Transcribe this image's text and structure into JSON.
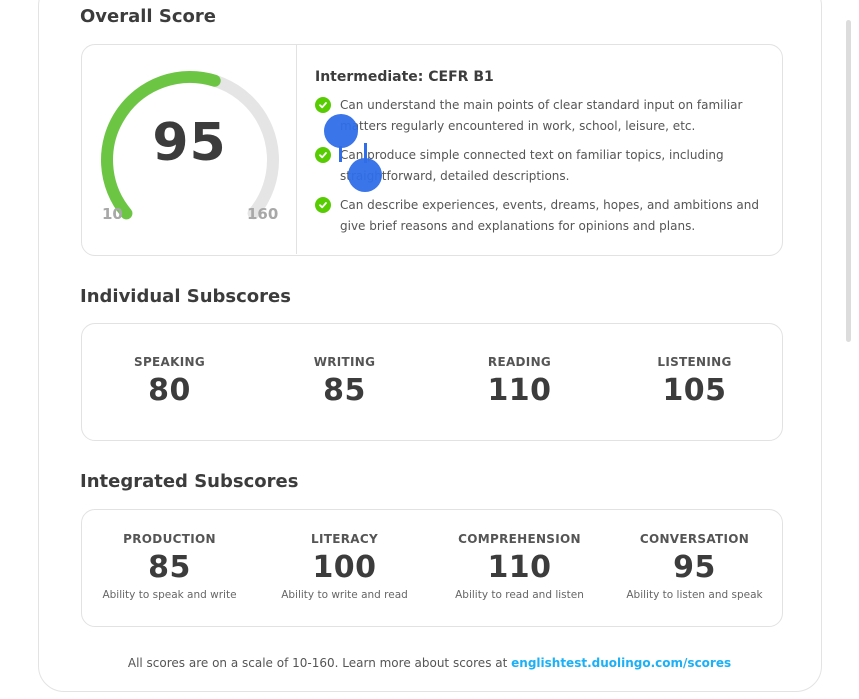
{
  "overall": {
    "title": "Overall Score",
    "score": "95",
    "score_numeric": 95,
    "min_label": "10",
    "max_label": "160",
    "min": 10,
    "max": 160,
    "level": "Intermediate: CEFR B1",
    "descriptions": [
      "Can understand the main points of clear standard input on familiar matters regularly encountered in work, school, leisure, etc.",
      "Can produce simple connected text on familiar topics, including straightforward, detailed descriptions.",
      "Can describe experiences, events, dreams, hopes, and ambitions and give brief reasons and explanations for opinions and plans."
    ]
  },
  "individual": {
    "title": "Individual Subscores",
    "items": [
      {
        "label": "SPEAKING",
        "value": "80"
      },
      {
        "label": "WRITING",
        "value": "85"
      },
      {
        "label": "READING",
        "value": "110"
      },
      {
        "label": "LISTENING",
        "value": "105"
      }
    ]
  },
  "integrated": {
    "title": "Integrated Subscores",
    "items": [
      {
        "label": "PRODUCTION",
        "value": "85",
        "desc": "Ability to speak and write"
      },
      {
        "label": "LITERACY",
        "value": "100",
        "desc": "Ability to write and read"
      },
      {
        "label": "COMPREHENSION",
        "value": "110",
        "desc": "Ability to read and listen"
      },
      {
        "label": "CONVERSATION",
        "value": "95",
        "desc": "Ability to listen and speak"
      }
    ]
  },
  "footer": {
    "text": "All scores are on a scale of 10-160. Learn more about scores at ",
    "link": "englishtest.duolingo.com/scores"
  },
  "colors": {
    "gauge_fill": "#6cc644",
    "gauge_track": "#e5e5e5",
    "check": "#58cc02",
    "link": "#1cb0f6",
    "selection": "#2f6ee8"
  }
}
